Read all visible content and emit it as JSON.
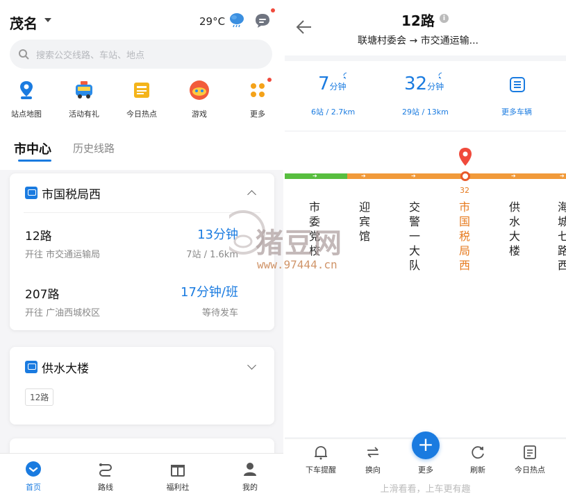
{
  "left": {
    "city": "茂名",
    "temperature": "29°C",
    "search_placeholder": "搜索公交线路、车站、地点",
    "quick_actions": [
      {
        "label": "站点地图",
        "icon": "stop-map-icon"
      },
      {
        "label": "活动有礼",
        "icon": "gift-bus-icon"
      },
      {
        "label": "今日热点",
        "icon": "hot-news-icon"
      },
      {
        "label": "游戏",
        "icon": "game-icon"
      },
      {
        "label": "更多",
        "icon": "more-dots-icon"
      }
    ],
    "tabs": {
      "active": "市中心",
      "other": "历史线路"
    },
    "cards": [
      {
        "stop": "市国税局西",
        "routes": [
          {
            "no": "12路",
            "dest": "开往 市交通运输局",
            "time": "13分钟",
            "status": "7站 / 1.6km"
          },
          {
            "no": "207路",
            "dest": "开往 广油西城校区",
            "time": "17分钟/班",
            "status": "等待发车"
          }
        ]
      },
      {
        "stop": "供水大楼",
        "chips": [
          "12路"
        ]
      }
    ],
    "bottom_nav": [
      {
        "label": "首页",
        "icon": "home-icon",
        "active": true
      },
      {
        "label": "路线",
        "icon": "route-icon",
        "active": false
      },
      {
        "label": "福利社",
        "icon": "gift-icon",
        "active": false
      },
      {
        "label": "我的",
        "icon": "profile-icon",
        "active": false
      }
    ]
  },
  "right": {
    "title": "12路",
    "info": "i",
    "subtitle": "联塘村委会 → 市交通运输...",
    "etas": [
      {
        "minutes": "7",
        "unit": "分钟",
        "detail": "6站 / 2.7km"
      },
      {
        "minutes": "32",
        "unit": "分钟",
        "detail": "29站 / 13km"
      }
    ],
    "more_vehicles": "更多车辆",
    "current_stop_number": "32",
    "stops": [
      "市委党校",
      "迎宾馆",
      "交警一大队",
      "市国税局西",
      "供水大楼",
      "海城七路西"
    ],
    "current_stop_index": 3,
    "toolbar": [
      {
        "label": "下车提醒",
        "icon": "bell-icon"
      },
      {
        "label": "换向",
        "icon": "swap-icon"
      },
      {
        "label": "更多",
        "icon": "plus-icon"
      },
      {
        "label": "刷新",
        "icon": "refresh-icon"
      },
      {
        "label": "今日热点",
        "icon": "news-icon"
      }
    ],
    "fab": "+",
    "swipe_hint": "上滑看看，上车更有趣"
  },
  "watermark": {
    "text": "猪豆网",
    "url": "www.97444.cn"
  },
  "colors": {
    "accent": "#1a7be0",
    "route_green": "#58be3f",
    "route_orange": "#f19a3a",
    "current_stop": "#e67a1e"
  }
}
